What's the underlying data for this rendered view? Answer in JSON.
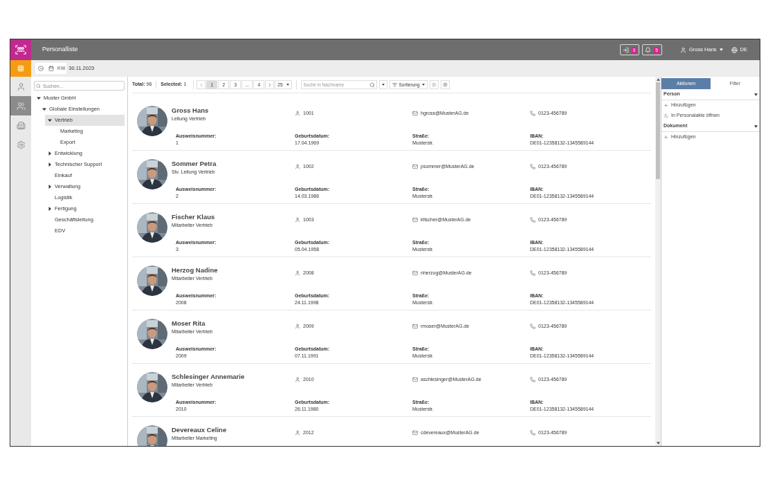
{
  "app": {
    "title": "Personalliste",
    "badges": [
      {
        "kind": "tasks",
        "count": "0"
      },
      {
        "kind": "bell",
        "count": "5"
      }
    ],
    "user": "Gross Hans",
    "language": "DE"
  },
  "toolbar": {
    "date": "30.11.2023",
    "kw": "KW"
  },
  "rail": [
    {
      "kind": "person",
      "selected": false
    },
    {
      "kind": "people",
      "selected": true
    },
    {
      "kind": "building",
      "selected": false
    },
    {
      "kind": "settings",
      "selected": false
    }
  ],
  "tree": {
    "search_placeholder": "Suchen...",
    "items": [
      {
        "label": "Muster GmbH",
        "expanded": true,
        "selected": false,
        "children": [
          {
            "label": "Globale Einstellungen",
            "expanded": true,
            "selected": false,
            "children": [
              {
                "label": "Vertrieb",
                "expanded": true,
                "selected": true,
                "children": [
                  {
                    "label": "Marketing",
                    "selected": false
                  },
                  {
                    "label": "Export",
                    "selected": false
                  }
                ]
              },
              {
                "label": "Entwicklung",
                "expanded": false,
                "selected": false
              },
              {
                "label": "Technischer Support",
                "expanded": false,
                "selected": false
              },
              {
                "label": "Einkauf",
                "selected": false
              },
              {
                "label": "Verwaltung",
                "expanded": false,
                "selected": false
              },
              {
                "label": "Logistik",
                "selected": false
              },
              {
                "label": "Fertigung",
                "expanded": false,
                "selected": false
              },
              {
                "label": "Geschäftsleitung",
                "selected": false
              },
              {
                "label": "EDV",
                "selected": false
              }
            ]
          }
        ]
      }
    ]
  },
  "list_toolbar": {
    "total_label": "Total:",
    "total": "96",
    "selected_label": "Selected:",
    "selected": "1",
    "pages": [
      {
        "label": "1",
        "selected": true
      },
      {
        "label": "2",
        "selected": false
      },
      {
        "label": "3",
        "selected": false
      },
      {
        "label": "...",
        "selected": false
      },
      {
        "label": "4",
        "selected": false
      }
    ],
    "page_size": "25",
    "search_placeholder": "Suche in Nachname",
    "sort": "Sortierung"
  },
  "people": [
    {
      "name": "Gross Hans",
      "role": "Leitung Vertrieb",
      "id": "1001",
      "email": "hgross@MusterAG.de",
      "phone": "0123-456789",
      "fields": [
        {
          "label": "Ausweisnummer:",
          "value": "1"
        },
        {
          "label": "Geburtsdatum:",
          "value": "17.04.1969"
        },
        {
          "label": "Straße:",
          "value": "Musterstr."
        },
        {
          "label": "IBAN:",
          "value": "DE01-12358132-1345589144"
        }
      ]
    },
    {
      "name": "Sommer Petra",
      "role": "Stv. Leitung Vertrieb",
      "id": "1002",
      "email": "psommer@MusterAG.de",
      "phone": "0123-456789",
      "fields": [
        {
          "label": "Ausweisnummer:",
          "value": "2"
        },
        {
          "label": "Geburtsdatum:",
          "value": "14.03.1986"
        },
        {
          "label": "Straße:",
          "value": "Musterstr."
        },
        {
          "label": "IBAN:",
          "value": "DE01-12358132-1345589144"
        }
      ]
    },
    {
      "name": "Fischer Klaus",
      "role": "Mitarbeiter Vertrieb",
      "id": "1003",
      "email": "kfischer@MusterAG.de",
      "phone": "0123-456789",
      "fields": [
        {
          "label": "Ausweisnummer:",
          "value": "3"
        },
        {
          "label": "Geburtsdatum:",
          "value": "05.04.1958"
        },
        {
          "label": "Straße:",
          "value": "Musterstr."
        },
        {
          "label": "IBAN:",
          "value": "DE01-12358132-1345589144"
        }
      ]
    },
    {
      "name": "Herzog Nadine",
      "role": "Mitarbeiter Vertrieb",
      "id": "2008",
      "email": "nherzog@MusterAG.de",
      "phone": "0123-456789",
      "fields": [
        {
          "label": "Ausweisnummer:",
          "value": "2008"
        },
        {
          "label": "Geburtsdatum:",
          "value": "24.11.1998"
        },
        {
          "label": "Straße:",
          "value": "Musterstr."
        },
        {
          "label": "IBAN:",
          "value": "DE01-12358132-1345589144"
        }
      ]
    },
    {
      "name": "Moser Rita",
      "role": "Mitarbeiter Vertrieb",
      "id": "2009",
      "email": "rmoser@MusterAG.de",
      "phone": "0123-456789",
      "fields": [
        {
          "label": "Ausweisnummer:",
          "value": "2009"
        },
        {
          "label": "Geburtsdatum:",
          "value": "07.11.1991"
        },
        {
          "label": "Straße:",
          "value": "Musterstr."
        },
        {
          "label": "IBAN:",
          "value": "DE01-12358132-1345589144"
        }
      ]
    },
    {
      "name": "Schlesinger Annemarie",
      "role": "Mitarbeiter Vertrieb",
      "id": "2010",
      "email": "aschlesinger@MusterAG.de",
      "phone": "0123-456789",
      "fields": [
        {
          "label": "Ausweisnummer:",
          "value": "2010"
        },
        {
          "label": "Geburtsdatum:",
          "value": "26.11.1980"
        },
        {
          "label": "Straße:",
          "value": "Musterstr."
        },
        {
          "label": "IBAN:",
          "value": "DE01-12358132-1345589144"
        }
      ]
    },
    {
      "name": "Devereaux Celine",
      "role": "Mitarbeiter Marketing",
      "id": "2012",
      "email": "cdevereaux@MusterAG.de",
      "phone": "0123-456789"
    }
  ],
  "side_panel": {
    "tabs": [
      {
        "label": "Aktionen",
        "selected": true
      },
      {
        "label": "Filter",
        "selected": false
      }
    ],
    "sections": [
      {
        "title": "Person",
        "expanded": true,
        "actions": [
          {
            "kind": "add",
            "label": "Hinzufügen"
          },
          {
            "kind": "open",
            "label": "In Personalakte öffnen"
          }
        ]
      },
      {
        "title": "Dokument",
        "expanded": true,
        "actions": [
          {
            "kind": "add",
            "label": "Hinzufügen"
          }
        ]
      }
    ]
  }
}
